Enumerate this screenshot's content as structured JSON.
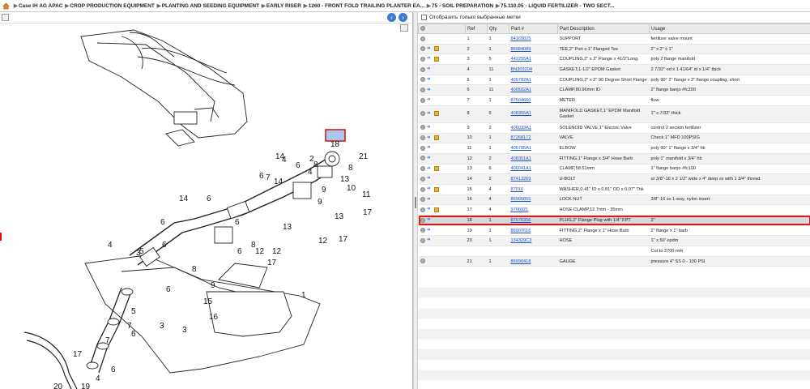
{
  "breadcrumb": [
    "Case IH AG APAC",
    "CROP PRODUCTION EQUIPMENT",
    "PLANTING AND SEEDING EQUIPMENT",
    "EARLY RISER",
    "1260 - FRONT FOLD TRAILING PLANTER EA...",
    "75 - SOIL PREPARATION",
    "75.110.05 - LIQUID FERTILIZER - TWO SECT..."
  ],
  "filter_label": "Отобразить только выбранные метки",
  "nav": {
    "back": "‹",
    "forward": "›"
  },
  "columns": [
    "",
    "Ref",
    "Qty",
    "Part #",
    "Part Description",
    "Usage"
  ],
  "selected_ref": "18",
  "rows": [
    {
      "icons": [
        "dot"
      ],
      "ref": "1",
      "qty": "1",
      "part": "84169825",
      "desc": "SUPPORT",
      "usage": "fertilizer valve mount"
    },
    {
      "icons": [
        "dot",
        "arrow",
        "box"
      ],
      "ref": "2",
      "qty": "1",
      "part": "86984089",
      "desc": "TEE,2\" Port x 1\" Flanged Tee",
      "usage": "2\" x 2\" x 1\""
    },
    {
      "icons": [
        "dot",
        "arrow",
        "box"
      ],
      "ref": "3",
      "qty": "5",
      "part": "442255A1",
      "desc": "COUPLING,2\" x 2\" Flange x 41/2\"Long",
      "usage": "poly 2 flange manifold"
    },
    {
      "icons": [
        "dot",
        "arrow"
      ],
      "ref": "4",
      "qty": "11",
      "part": "BN303204",
      "desc": "GASKET,1-1/2\" EPDM Gasket",
      "usage": "2 7/32\" od x 1 41/64\" id x 1/4\" thick"
    },
    {
      "icons": [
        "dot",
        "arrow"
      ],
      "ref": "5",
      "qty": "1",
      "part": "405782A1",
      "desc": "COUPLING,2\" x 2\" 90 Degree Short Flange",
      "usage": "poly 90° 2\" flange x 2\" flange coupling, short"
    },
    {
      "icons": [
        "dot",
        "arrow"
      ],
      "ref": "6",
      "qty": "11",
      "part": "400502A1",
      "desc": "CLAMP,80.96mm ID",
      "usage": "2\" flange banjo #fc200"
    },
    {
      "icons": [
        "dot",
        "green"
      ],
      "ref": "7",
      "qty": "1",
      "part": "87504660",
      "desc": "METER",
      "usage": "flow"
    },
    {
      "icons": [
        "dot",
        "arrow",
        "box"
      ],
      "ref": "8",
      "qty": "6",
      "part": "408355A1",
      "desc": "MANIFOLD GASKET,1\" EPDM Manifold Gasket",
      "usage": "1\" x 7/32\" thick",
      "tall": true
    },
    {
      "icons": [
        "dot",
        "arrow"
      ],
      "ref": "9",
      "qty": "2",
      "part": "406039A1",
      "desc": "SOLENOID VALVE,1\" Electric Valve",
      "usage": "control 2 section fertilizer"
    },
    {
      "icons": [
        "dot",
        "arrow",
        "box"
      ],
      "ref": "10",
      "qty": "1",
      "part": "87268172",
      "desc": "VALVE",
      "usage": "Check 1\" MFD 100PSIG"
    },
    {
      "icons": [
        "dot",
        "arrow"
      ],
      "ref": "11",
      "qty": "1",
      "part": "405785A1",
      "desc": "ELBOW",
      "usage": "poly 90° 1\" flange x 3/4\" hb"
    },
    {
      "icons": [
        "dot",
        "arrow"
      ],
      "ref": "12",
      "qty": "2",
      "part": "408351A1",
      "desc": "FITTING,1\" Flange x 3/4\" Hose Barb",
      "usage": "poly 1\" manifold x 3/4\" hb"
    },
    {
      "icons": [
        "dot",
        "arrow",
        "box"
      ],
      "ref": "13",
      "qty": "6",
      "part": "406041A1",
      "desc": "CLAMP,58.51mm",
      "usage": "1\" flange banjo #fc100"
    },
    {
      "icons": [
        "dot",
        "arrow"
      ],
      "ref": "14",
      "qty": "2",
      "part": "87413269",
      "desc": "U-BOLT",
      "usage": "ur 3/8\"-16 x 2 1/2\" wide x 4\" deep ss with 1 3/4\" thread"
    },
    {
      "icons": [
        "dot",
        "arrow",
        "box"
      ],
      "ref": "15",
      "qty": "4",
      "part": "87016",
      "desc": "WASHER,0.41\" ID x 0.81\" OD x 0.07\" Thk",
      "usage": ""
    },
    {
      "icons": [
        "dot",
        "arrow"
      ],
      "ref": "16",
      "qty": "4",
      "part": "86905855",
      "desc": "LOCK NUT",
      "usage": "3/8\"-16 ss 1-way, nylon insert"
    },
    {
      "icons": [
        "dot",
        "arrow",
        "box"
      ],
      "ref": "17",
      "qty": "4",
      "part": "9706921",
      "desc": "HOSE CLAMP,12.7mm - 35mm",
      "usage": ""
    },
    {
      "icons": [
        "dot",
        "arrow"
      ],
      "ref": "18",
      "qty": "1",
      "part": "87676356",
      "desc": "PLUG,2\" Flange Plug with 1/4\" FPT",
      "usage": "2\""
    },
    {
      "icons": [
        "dot",
        "arrow"
      ],
      "ref": "19",
      "qty": "1",
      "part": "86907616",
      "desc": "FITTING,2\" Flange x 1\" Hose Barb",
      "usage": "2\" flange x 1\" barb"
    },
    {
      "icons": [
        "dot",
        "arrow"
      ],
      "ref": "20",
      "qty": "1",
      "part": "134329C3",
      "desc": "HOSE",
      "usage": "1\" x 50' epdm"
    },
    {
      "icons": [],
      "ref": "",
      "qty": "",
      "part": "",
      "desc": "",
      "usage": "Cut to 2700 mm"
    },
    {
      "icons": [
        "dot"
      ],
      "ref": "21",
      "qty": "1",
      "part": "86990418",
      "desc": "GAUGE",
      "usage": "pressure 4\" SS 0 - 100 PSI"
    }
  ],
  "callouts": [
    "1",
    "2",
    "3",
    "3",
    "3",
    "4",
    "4",
    "4",
    "4",
    "5",
    "5",
    "6",
    "6",
    "6",
    "6",
    "6",
    "6",
    "6",
    "6",
    "6",
    "6",
    "7",
    "7",
    "7",
    "8",
    "8",
    "8",
    "8",
    "9",
    "9",
    "9",
    "10",
    "11",
    "12",
    "12",
    "12",
    "13",
    "13",
    "13",
    "14",
    "14",
    "14",
    "15",
    "16",
    "17",
    "17",
    "17",
    "17",
    "18",
    "19",
    "20",
    "21"
  ]
}
